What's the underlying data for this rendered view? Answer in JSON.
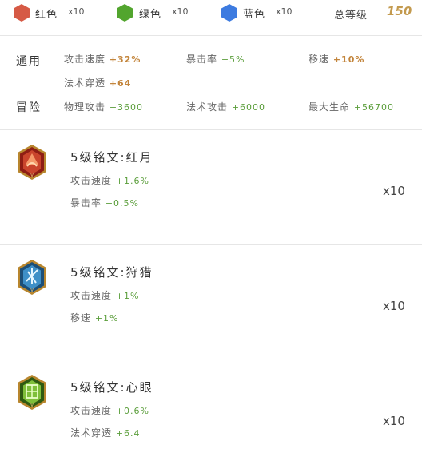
{
  "header": {
    "red": {
      "label": "红色",
      "count": "x10",
      "color": "#d65a45"
    },
    "green": {
      "label": "绿色",
      "count": "x10",
      "color": "#52a52e"
    },
    "blue": {
      "label": "蓝色",
      "count": "x10",
      "color": "#3d7be0"
    },
    "total_label": "总等级",
    "total_value": "150"
  },
  "stats": {
    "general_label": "通用",
    "adventure_label": "冒险",
    "attack_speed": {
      "label": "攻击速度",
      "value": "+32%"
    },
    "crit_rate": {
      "label": "暴击率",
      "value": "+5%"
    },
    "move_speed": {
      "label": "移速",
      "value": "+10%"
    },
    "magic_pen": {
      "label": "法术穿透",
      "value": "+64"
    },
    "phys_attack": {
      "label": "物理攻击",
      "value": "+3600"
    },
    "magic_attack": {
      "label": "法术攻击",
      "value": "+6000"
    },
    "max_hp": {
      "label": "最大生命",
      "value": "+56700"
    }
  },
  "runes": [
    {
      "title": "5级铭文:红月",
      "icon": "red-moon-rune-icon",
      "stats": [
        {
          "label": "攻击速度",
          "value": "+1.6%"
        },
        {
          "label": "暴击率",
          "value": "+0.5%"
        }
      ],
      "qty": "x10"
    },
    {
      "title": "5级铭文:狩猎",
      "icon": "hunt-rune-icon",
      "stats": [
        {
          "label": "攻击速度",
          "value": "+1%"
        },
        {
          "label": "移速",
          "value": "+1%"
        }
      ],
      "qty": "x10"
    },
    {
      "title": "5级铭文:心眼",
      "icon": "mind-eye-rune-icon",
      "stats": [
        {
          "label": "攻击速度",
          "value": "+0.6%"
        },
        {
          "label": "法术穿透",
          "value": "+6.4"
        }
      ],
      "qty": "x10"
    }
  ]
}
